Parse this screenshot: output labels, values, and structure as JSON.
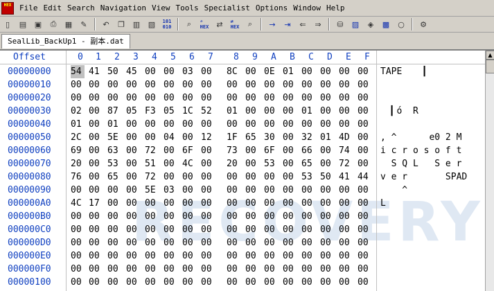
{
  "app": {
    "icon_text": "HEX"
  },
  "menu": [
    "File",
    "Edit",
    "Search",
    "Navigation",
    "View",
    "Tools",
    "Specialist",
    "Options",
    "Window",
    "Help"
  ],
  "tab": {
    "label": "SealLib_BackUp1 - 副本.dat"
  },
  "header": {
    "offset_label": "Offset",
    "columns": [
      "0",
      "1",
      "2",
      "3",
      "4",
      "5",
      "6",
      "7",
      "8",
      "9",
      "A",
      "B",
      "C",
      "D",
      "E",
      "F"
    ]
  },
  "rows": [
    {
      "offset": "00000000",
      "bytes": [
        "54",
        "41",
        "50",
        "45",
        "00",
        "00",
        "03",
        "00",
        "8C",
        "00",
        "0E",
        "01",
        "00",
        "00",
        "00",
        "00"
      ],
      "text": "TAPE    ▎"
    },
    {
      "offset": "00000010",
      "bytes": [
        "00",
        "00",
        "00",
        "00",
        "00",
        "00",
        "00",
        "00",
        "00",
        "00",
        "00",
        "00",
        "00",
        "00",
        "00",
        "00"
      ],
      "text": ""
    },
    {
      "offset": "00000020",
      "bytes": [
        "00",
        "00",
        "00",
        "00",
        "00",
        "00",
        "00",
        "00",
        "00",
        "00",
        "00",
        "00",
        "00",
        "00",
        "00",
        "00"
      ],
      "text": ""
    },
    {
      "offset": "00000030",
      "bytes": [
        "02",
        "00",
        "87",
        "05",
        "F3",
        "05",
        "1C",
        "52",
        "01",
        "00",
        "00",
        "00",
        "01",
        "00",
        "00",
        "00"
      ],
      "text": "  ▎ó  R"
    },
    {
      "offset": "00000040",
      "bytes": [
        "01",
        "00",
        "01",
        "00",
        "00",
        "00",
        "00",
        "00",
        "00",
        "00",
        "00",
        "00",
        "00",
        "00",
        "00",
        "00"
      ],
      "text": ""
    },
    {
      "offset": "00000050",
      "bytes": [
        "2C",
        "00",
        "5E",
        "00",
        "00",
        "04",
        "00",
        "12",
        "1F",
        "65",
        "30",
        "00",
        "32",
        "01",
        "4D",
        "00"
      ],
      "text": ", ^      e0 2 M"
    },
    {
      "offset": "00000060",
      "bytes": [
        "69",
        "00",
        "63",
        "00",
        "72",
        "00",
        "6F",
        "00",
        "73",
        "00",
        "6F",
        "00",
        "66",
        "00",
        "74",
        "00"
      ],
      "text": "i c r o s o f t"
    },
    {
      "offset": "00000070",
      "bytes": [
        "20",
        "00",
        "53",
        "00",
        "51",
        "00",
        "4C",
        "00",
        "20",
        "00",
        "53",
        "00",
        "65",
        "00",
        "72",
        "00"
      ],
      "text": "  S Q L   S e r"
    },
    {
      "offset": "00000080",
      "bytes": [
        "76",
        "00",
        "65",
        "00",
        "72",
        "00",
        "00",
        "00",
        "00",
        "00",
        "00",
        "00",
        "53",
        "50",
        "41",
        "44"
      ],
      "text": "v e r       SPAD"
    },
    {
      "offset": "00000090",
      "bytes": [
        "00",
        "00",
        "00",
        "00",
        "5E",
        "03",
        "00",
        "00",
        "00",
        "00",
        "00",
        "00",
        "00",
        "00",
        "00",
        "00"
      ],
      "text": "    ^"
    },
    {
      "offset": "000000A0",
      "bytes": [
        "4C",
        "17",
        "00",
        "00",
        "00",
        "00",
        "00",
        "00",
        "00",
        "00",
        "00",
        "00",
        "00",
        "00",
        "00",
        "00"
      ],
      "text": "L"
    },
    {
      "offset": "000000B0",
      "bytes": [
        "00",
        "00",
        "00",
        "00",
        "00",
        "00",
        "00",
        "00",
        "00",
        "00",
        "00",
        "00",
        "00",
        "00",
        "00",
        "00"
      ],
      "text": ""
    },
    {
      "offset": "000000C0",
      "bytes": [
        "00",
        "00",
        "00",
        "00",
        "00",
        "00",
        "00",
        "00",
        "00",
        "00",
        "00",
        "00",
        "00",
        "00",
        "00",
        "00"
      ],
      "text": ""
    },
    {
      "offset": "000000D0",
      "bytes": [
        "00",
        "00",
        "00",
        "00",
        "00",
        "00",
        "00",
        "00",
        "00",
        "00",
        "00",
        "00",
        "00",
        "00",
        "00",
        "00"
      ],
      "text": ""
    },
    {
      "offset": "000000E0",
      "bytes": [
        "00",
        "00",
        "00",
        "00",
        "00",
        "00",
        "00",
        "00",
        "00",
        "00",
        "00",
        "00",
        "00",
        "00",
        "00",
        "00"
      ],
      "text": ""
    },
    {
      "offset": "000000F0",
      "bytes": [
        "00",
        "00",
        "00",
        "00",
        "00",
        "00",
        "00",
        "00",
        "00",
        "00",
        "00",
        "00",
        "00",
        "00",
        "00",
        "00"
      ],
      "text": ""
    },
    {
      "offset": "00000100",
      "bytes": [
        "00",
        "00",
        "00",
        "00",
        "00",
        "00",
        "00",
        "00",
        "00",
        "00",
        "00",
        "00",
        "00",
        "00",
        "00",
        "00"
      ],
      "text": ""
    }
  ],
  "watermark": "RECOVERY",
  "toolbar_icons": [
    "new-file-icon",
    "open-icon",
    "save-icon",
    "print-icon",
    "properties-icon",
    "open-folder-icon",
    "undo-icon",
    "copy-icon",
    "paste-icon",
    "paste-special-icon",
    "binary-icon",
    "find-icon",
    "find-hex-icon",
    "replace-icon",
    "replace-hex-icon",
    "find-next-icon",
    "goto-arrow-icon",
    "goto-offset-icon",
    "back-icon",
    "forward-icon",
    "disk-editor-icon",
    "ram-editor-icon",
    "sector-icon",
    "calculator-icon",
    "search-lens-icon",
    "settings-icon"
  ]
}
